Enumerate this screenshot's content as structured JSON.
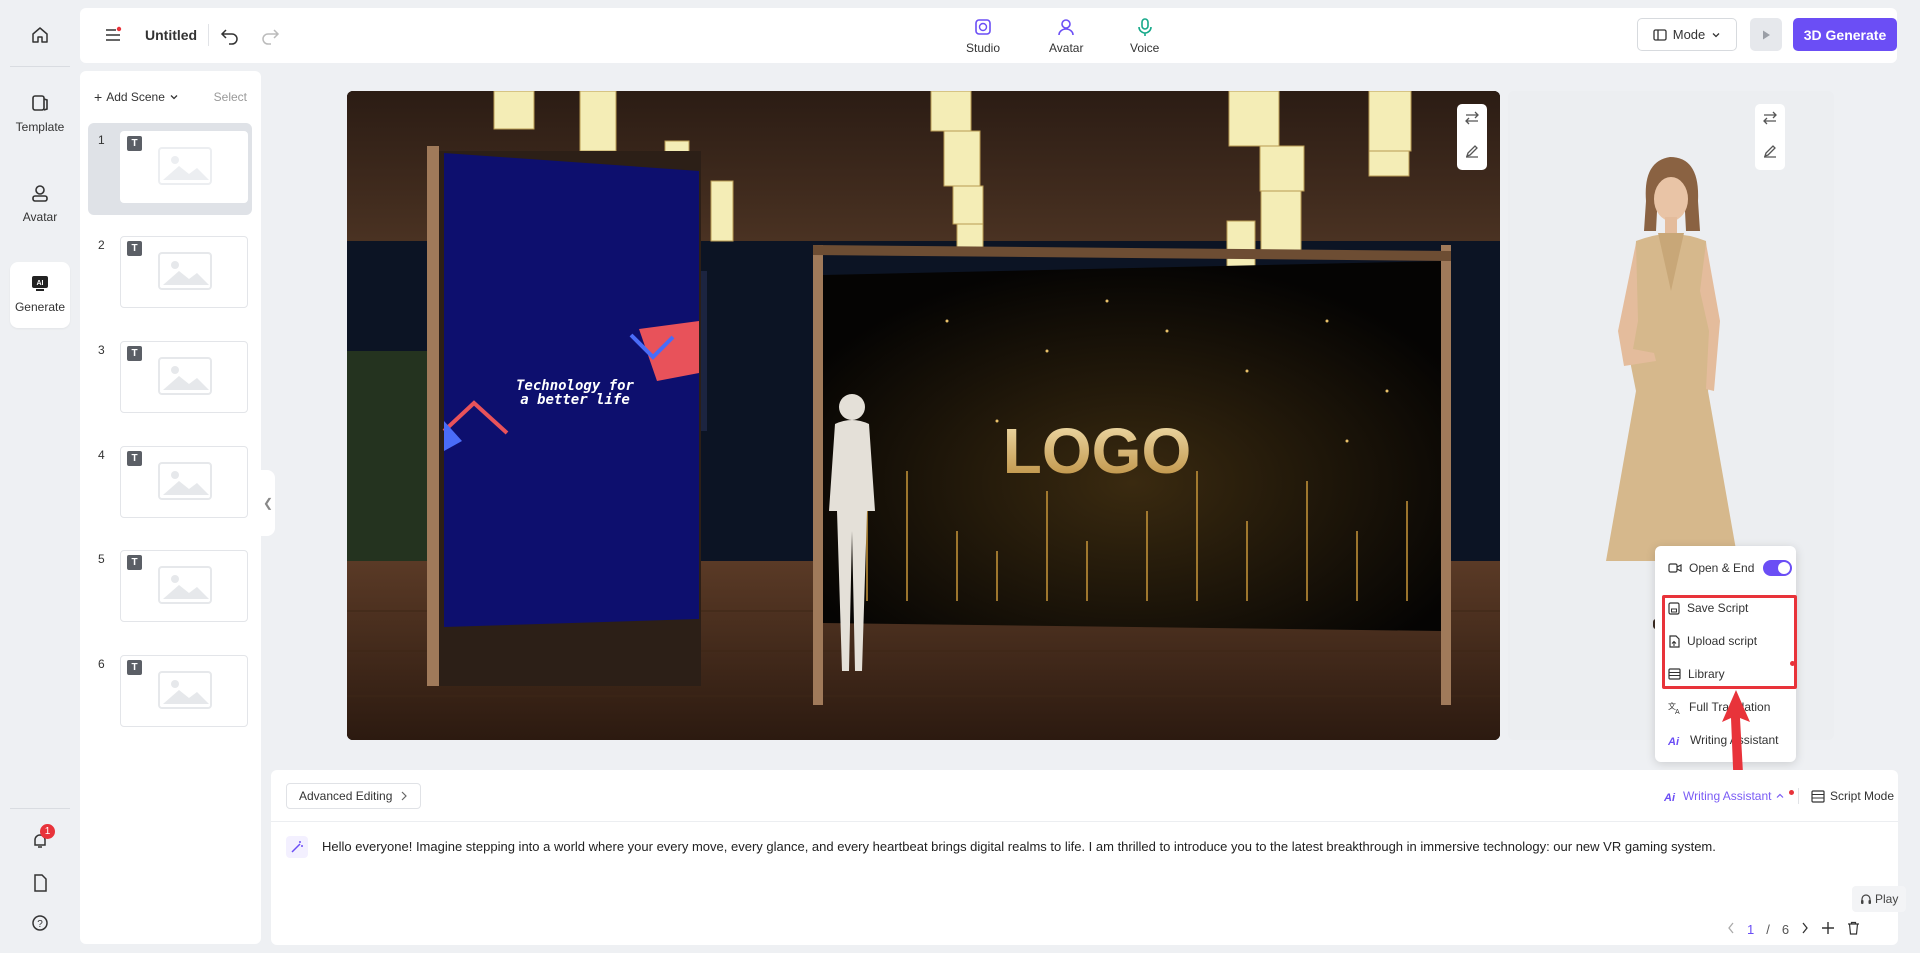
{
  "app": {
    "title": "Untitled",
    "accent": "#6b4ef5"
  },
  "rail": {
    "items": [
      {
        "label": "Template",
        "icon": "template-icon"
      },
      {
        "label": "Avatar",
        "icon": "avatar-icon"
      },
      {
        "label": "Generate",
        "icon": "ai-generate-icon"
      }
    ],
    "notification_count": "1"
  },
  "topbar": {
    "tabs": [
      {
        "label": "Studio",
        "icon": "studio-icon"
      },
      {
        "label": "Avatar",
        "icon": "avatar-icon"
      },
      {
        "label": "Voice",
        "icon": "microphone-icon"
      }
    ],
    "mode_label": "Mode",
    "generate_label": "3D Generate"
  },
  "scenes": {
    "add_label": "Add Scene",
    "select_label": "Select",
    "badge": "T",
    "empty_label": "empty",
    "items": [
      "1",
      "2",
      "3",
      "4",
      "5",
      "6"
    ]
  },
  "stage": {
    "banner_line1": "Technology for",
    "banner_line2": "a better life",
    "logo_text": "LOGO"
  },
  "popup": {
    "open_end": "Open & End",
    "save_script": "Save Script",
    "upload_script": "Upload script",
    "library": "Library",
    "full_translation": "Full Translation",
    "writing_assistant": "Writing Assistant"
  },
  "editor": {
    "advanced_label": "Advanced Editing",
    "writing_assistant": "Writing Assistant",
    "script_mode": "Script Mode",
    "script_text": "Hello everyone! Imagine stepping into a world where your every move, every glance, and every heartbeat brings digital realms to life. I am thrilled to introduce you to the latest breakthrough in immersive technology: our new VR gaming system.",
    "play_label": "Play",
    "page_current": "1",
    "page_sep": "/",
    "page_total": "6"
  }
}
